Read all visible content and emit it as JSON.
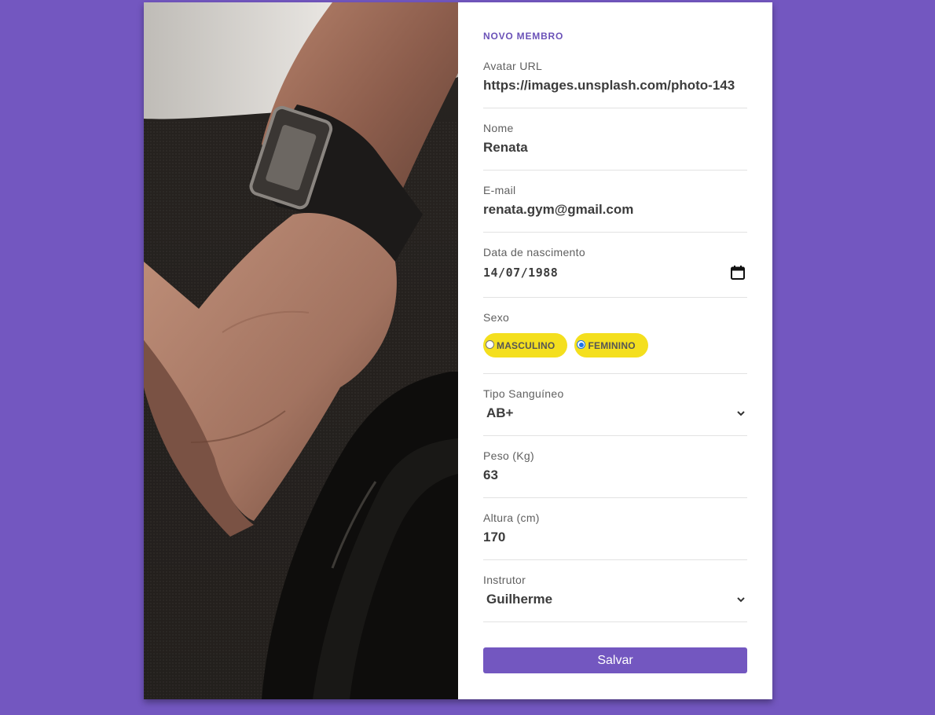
{
  "form": {
    "title": "NOVO MEMBRO",
    "avatar": {
      "label": "Avatar URL",
      "value": "https://images.unsplash.com/photo-143"
    },
    "name": {
      "label": "Nome",
      "value": "Renata"
    },
    "email": {
      "label": "E-mail",
      "value": "renata.gym@gmail.com"
    },
    "birthdate": {
      "label": "Data de nascimento",
      "value": "14/07/1988"
    },
    "sex": {
      "label": "Sexo",
      "options": [
        {
          "label": "MASCULINO",
          "checked": false
        },
        {
          "label": "FEMININO",
          "checked": true
        }
      ]
    },
    "blood_type": {
      "label": "Tipo Sanguíneo",
      "value": "AB+"
    },
    "weight": {
      "label": "Peso (Kg)",
      "value": "63"
    },
    "height": {
      "label": "Altura (cm)",
      "value": "170"
    },
    "instructor": {
      "label": "Instrutor",
      "value": "Guilherme"
    },
    "save_label": "Salvar"
  },
  "colors": {
    "background": "#7357c0",
    "accent": "#6b52b8",
    "pill": "#f4df1e",
    "radio_checked": "#1a73e8"
  },
  "icons": {
    "date": "calendar-icon",
    "select": "chevron-down-icon"
  }
}
